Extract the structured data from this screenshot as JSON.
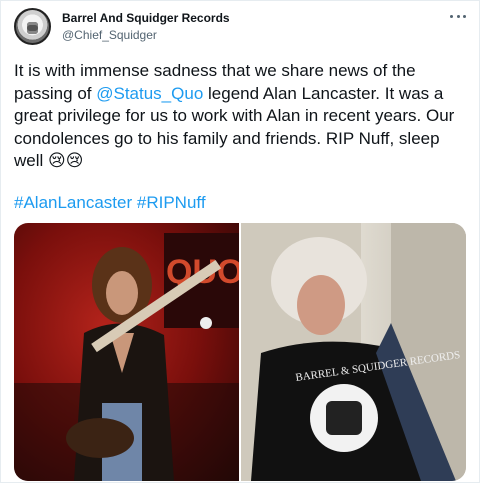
{
  "author": {
    "name": "Barrel And Squidger Records",
    "handle": "@Chief_Squidger"
  },
  "tweet": {
    "text_before_mention": "It is with immense sadness that we share news of the passing of ",
    "mention": "@Status_Quo",
    "text_after_mention": " legend Alan Lancaster. It was a great privilege for us to work with Alan in recent years. Our condolences go to his family and friends. RIP Nuff, sleep well ",
    "emoji": "😢😢",
    "hashtags": [
      "#AlanLancaster",
      "#RIPNuff"
    ]
  },
  "media": {
    "left_sign_text": "QUO",
    "right_shirt_text": "BARREL & SQUIDGER RECORDS"
  },
  "colors": {
    "link": "#1d9bf0",
    "text": "#0f1419",
    "secondary": "#536471"
  },
  "icons": {
    "more": "more-horizontal-icon"
  }
}
